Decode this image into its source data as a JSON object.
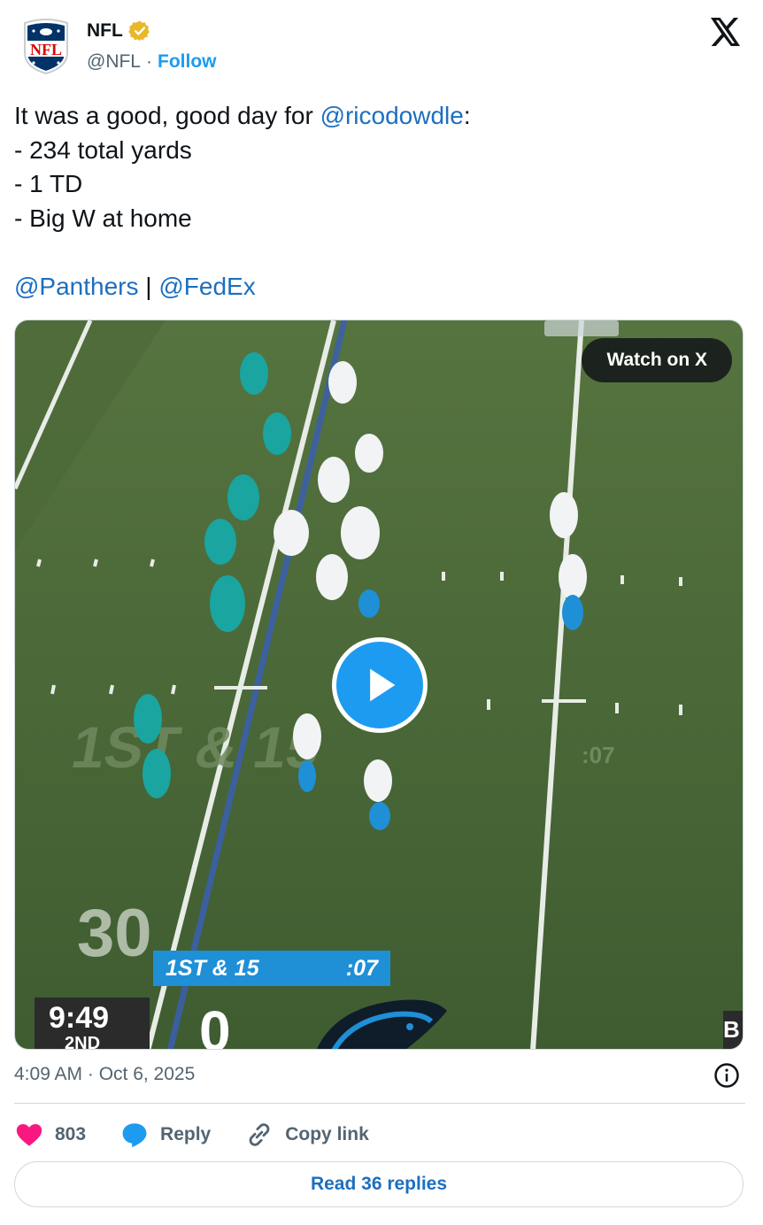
{
  "author": {
    "name": "NFL",
    "handle": "@NFL",
    "separator": "·",
    "follow_label": "Follow"
  },
  "tweet": {
    "line1_prefix": "It was a good, good day for ",
    "line1_mention": "@ricodowdle",
    "line1_suffix": ":",
    "line2": "- 234 total yards",
    "line3": "- 1 TD",
    "line4": "- Big W at home",
    "mention_panthers": "@Panthers",
    "mention_sep": " | ",
    "mention_fedex": "@FedEx"
  },
  "media": {
    "watch_label": "Watch on X",
    "down_distance": "1ST & 15",
    "play_clock": ":07",
    "game_clock": "9:49",
    "quarter": "2ND",
    "score": "0",
    "field_overlay": "1ST & 15",
    "yard_number": "30"
  },
  "meta": {
    "timestamp": "4:09 AM · Oct 6, 2025"
  },
  "actions": {
    "likes": "803",
    "reply_label": "Reply",
    "copy_label": "Copy link",
    "read_replies": "Read 36 replies"
  },
  "colors": {
    "accent": "#1d9bf0",
    "link": "#1d6fbf",
    "like": "#f91880",
    "verified": "#e8b829",
    "field": "#4d6b3a"
  }
}
